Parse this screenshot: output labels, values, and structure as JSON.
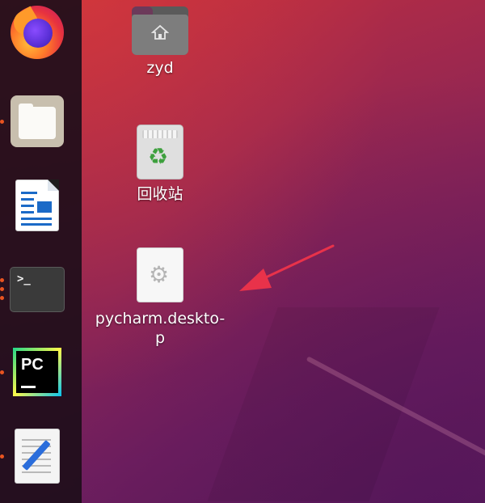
{
  "dock": {
    "items": [
      {
        "name": "firefox",
        "icon": "firefox-icon",
        "running": false
      },
      {
        "name": "files",
        "icon": "files-icon",
        "running": true
      },
      {
        "name": "libreoffice-writer",
        "icon": "libreoffice-writer-icon",
        "running": false
      },
      {
        "name": "terminal",
        "icon": "terminal-icon",
        "running": true
      },
      {
        "name": "pycharm",
        "icon": "pycharm-icon",
        "running": true
      },
      {
        "name": "text-editor",
        "icon": "text-editor-icon",
        "running": true
      }
    ],
    "terminal_prompt": ">_",
    "pycharm_label": "PC"
  },
  "desktop": {
    "icons": [
      {
        "label": "zyd",
        "icon": "home-folder-icon"
      },
      {
        "label": "回收站",
        "icon": "trash-icon"
      },
      {
        "label_line1": "pycharm.deskto-",
        "label_line2": "p",
        "icon": "desktop-file-gear-icon"
      }
    ]
  },
  "annotation": {
    "type": "arrow",
    "color": "#e8324a"
  },
  "colors": {
    "accent": "#e95420",
    "dock_bg": "#1e0e1a",
    "recycle_green": "#3ea03e"
  }
}
